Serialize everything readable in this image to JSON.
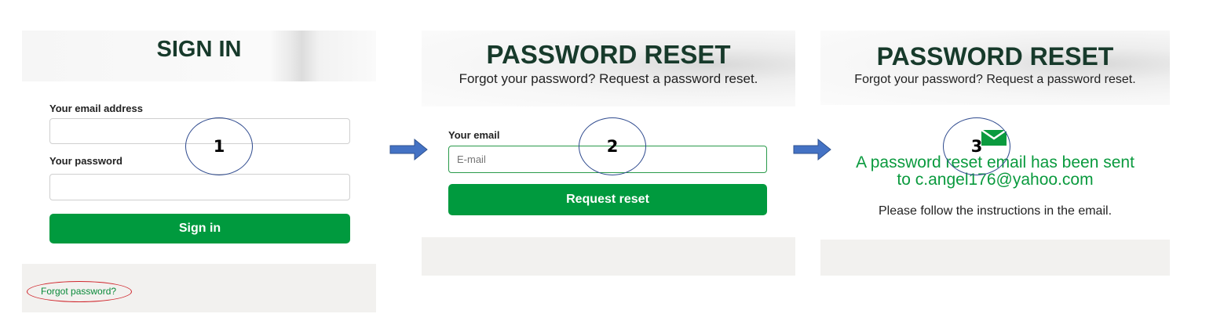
{
  "step1": {
    "title": "SIGN IN",
    "email_label": "Your email address",
    "email_value": "",
    "password_label": "Your password",
    "password_value": "",
    "signin_label": "Sign in",
    "forgot_link": "Forgot password?",
    "step_number": "1"
  },
  "step2": {
    "title": "PASSWORD RESET",
    "subtitle": "Forgot your password? Request a password reset.",
    "email_label": "Your email",
    "email_placeholder": "E-mail",
    "button_label": "Request reset",
    "step_number": "2"
  },
  "step3": {
    "title": "PASSWORD RESET",
    "subtitle": "Forgot your password? Request a password reset.",
    "icon": "envelope-icon",
    "success_line1": "A password reset email has been sent",
    "success_line2": "to c.angel176@yahoo.com",
    "instructions": "Please follow the instructions in the email.",
    "step_number": "3"
  },
  "colors": {
    "brand_green": "#009a3e",
    "title_green": "#173a2b",
    "annotation_blue": "#2e4a8e",
    "annotation_red": "#d0262c",
    "arrow_blue": "#4472c4"
  }
}
